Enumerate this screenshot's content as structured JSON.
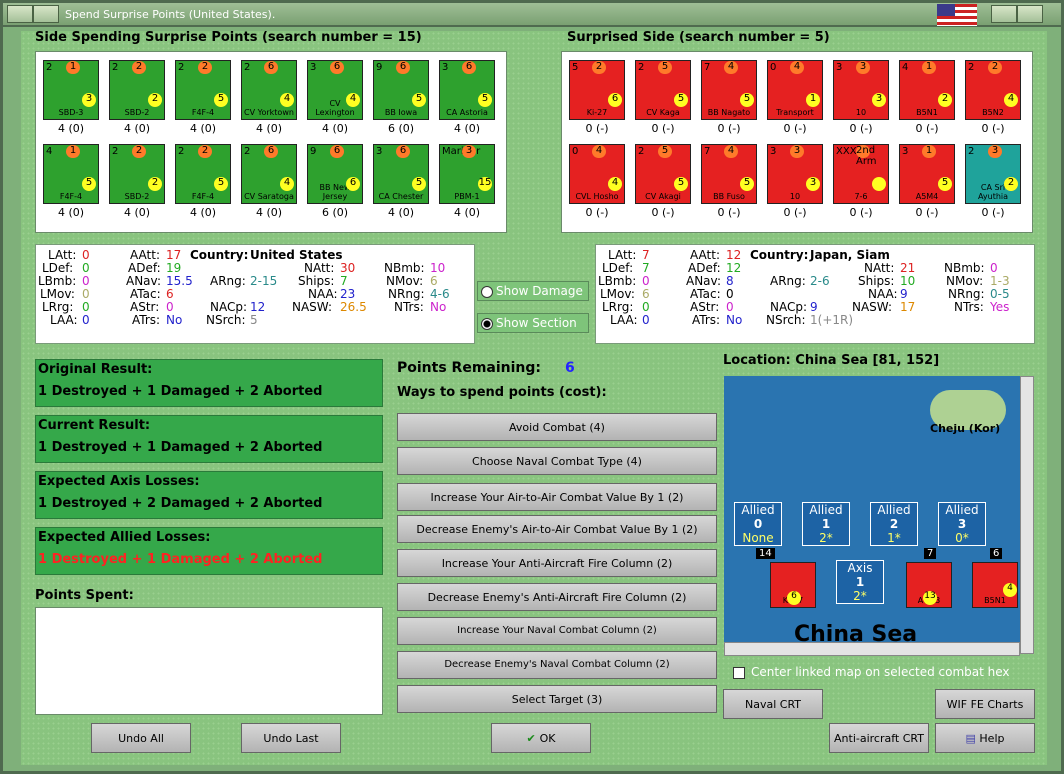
{
  "window": {
    "title": "Spend Surprise Points (United States)."
  },
  "left_header": "Side Spending Surprise Points (search number = 15)",
  "right_header": "Surprised Side (search number = 5)",
  "us_counters": [
    {
      "top": "2",
      "top_mid": "1",
      "name": "SBD-3",
      "bottom": "3",
      "val": "4 (0)"
    },
    {
      "top": "2",
      "top_mid": "2",
      "name": "SBD-2",
      "bottom": "2",
      "val": "4 (0)"
    },
    {
      "top": "2",
      "top_mid": "2",
      "name": "F4F-4",
      "bottom": "5",
      "val": "4 (0)"
    },
    {
      "top": "2",
      "top_mid": "6",
      "name": "CV Yorktown",
      "bottom": "4",
      "val": "4 (0)"
    },
    {
      "top": "3",
      "top_mid": "6",
      "name": "CV Lexington",
      "bottom": "4",
      "val": "4 (0)"
    },
    {
      "top": "9",
      "top_mid": "6",
      "name": "BB Iowa",
      "bottom": "5",
      "val": "6 (0)"
    },
    {
      "top": "3",
      "top_mid": "6",
      "name": "CA Astoria",
      "bottom": "5",
      "val": "4 (0)"
    },
    {
      "top": "4",
      "top_mid": "1",
      "name": "F4F-4",
      "bottom": "5",
      "val": "4 (0)"
    },
    {
      "top": "2",
      "top_mid": "2",
      "name": "SBD-2",
      "bottom": "2",
      "val": "4 (0)"
    },
    {
      "top": "2",
      "top_mid": "2",
      "name": "F4F-4",
      "bottom": "5",
      "val": "4 (0)"
    },
    {
      "top": "2",
      "top_mid": "6",
      "name": "CV Saratoga",
      "bottom": "4",
      "val": "4 (0)"
    },
    {
      "top": "9",
      "top_mid": "6",
      "name": "BB New Jersey",
      "bottom": "6",
      "val": "6 (0)"
    },
    {
      "top": "3",
      "top_mid": "6",
      "name": "CA Chester",
      "bottom": "5",
      "val": "4 (0)"
    },
    {
      "top": "Mariner",
      "top_mid": "3",
      "name": "PBM-1",
      "bottom": "15",
      "val": "4 (0)"
    }
  ],
  "jp_counters": [
    {
      "top": "5",
      "top_mid": "2",
      "name": "Ki-27",
      "bottom": "6",
      "val": "0 (-)"
    },
    {
      "top": "2",
      "top_mid": "5",
      "name": "CV Kaga",
      "bottom": "5",
      "val": "0 (-)"
    },
    {
      "top": "7",
      "top_mid": "4",
      "name": "BB Nagato",
      "bottom": "5",
      "val": "0 (-)"
    },
    {
      "top": "0",
      "top_mid": "4",
      "name": "Transport",
      "bottom": "1",
      "val": "0 (-)"
    },
    {
      "top": "3",
      "top_mid": "3",
      "name": "10",
      "bottom": "3",
      "val": "0 (-)"
    },
    {
      "top": "4",
      "top_mid": "1",
      "name": "B5N1",
      "bottom": "2",
      "val": "0 (-)"
    },
    {
      "top": "2",
      "top_mid": "2",
      "name": "B5N2",
      "bottom": "4",
      "val": "0 (-)"
    },
    {
      "top": "0",
      "top_mid": "4",
      "name": "CVL Hosho",
      "bottom": "4",
      "val": "0 (-)"
    },
    {
      "top": "2",
      "top_mid": "5",
      "name": "CV Akagi",
      "bottom": "5",
      "val": "0 (-)"
    },
    {
      "top": "7",
      "top_mid": "4",
      "name": "BB Fuso",
      "bottom": "5",
      "val": "0 (-)"
    },
    {
      "top": "3",
      "top_mid": "3",
      "name": "10",
      "bottom": "3",
      "val": "0 (-)"
    },
    {
      "top": "XXX",
      "top_mid": "2nd Arm",
      "name": "7-6",
      "bottom": "",
      "val": "0 (-)"
    },
    {
      "top": "3",
      "top_mid": "1",
      "name": "A5M4",
      "bottom": "5",
      "val": "0 (-)"
    },
    {
      "top": "2",
      "top_mid": "3",
      "name": "CA Sri Ayuthia",
      "bottom": "2",
      "val": "0 (-)"
    }
  ],
  "us_stats": {
    "country_label": "Country:",
    "country": "United States",
    "LAtt": "0",
    "LDef": "0",
    "LBmb": "0",
    "LMov": "0",
    "LRrg": "0",
    "LAA": "0",
    "AAtt": "17",
    "ADef": "19",
    "ANav": "15.5",
    "ATac": "6",
    "AStr": "0",
    "ATrs": "No",
    "ARng": "2-15",
    "NACp": "12",
    "NSrch": "5",
    "NAtt": "30",
    "Ships": "7",
    "NAA": "23",
    "NASW": "26.5",
    "NBmb": "10",
    "NMov": "6",
    "NRng": "4-6",
    "NTrs": "No"
  },
  "jp_stats": {
    "country_label": "Country:",
    "country": "Japan, Siam",
    "LAtt": "7",
    "LDef": "7",
    "LBmb": "0",
    "LMov": "6",
    "LRrg": "0",
    "LAA": "0",
    "AAtt": "12",
    "ADef": "12",
    "ANav": "8",
    "ATac": "0",
    "AStr": "0",
    "ATrs": "No",
    "ARng": "2-6",
    "NACp": "9",
    "NSrch": "1(+1R)",
    "NAtt": "21",
    "Ships": "10",
    "NAA": "9",
    "NASW": "17",
    "NBmb": "0",
    "NMov": "1-3",
    "NRng": "0-5",
    "NTrs": "Yes"
  },
  "options": {
    "show_damage": "Show Damage",
    "show_section": "Show Section"
  },
  "results": [
    {
      "title": "Original Result:",
      "text": "1 Destroyed + 1 Damaged + 2 Aborted"
    },
    {
      "title": "Current Result:",
      "text": "1 Destroyed + 1 Damaged + 2 Aborted"
    },
    {
      "title": "Expected Axis Losses:",
      "text": "1 Destroyed + 2 Damaged + 2 Aborted"
    },
    {
      "title": "Expected Allied Losses:",
      "text": "1 Destroyed + 1 Damaged + 2 Aborted"
    }
  ],
  "points_spent_label": "Points Spent:",
  "points_remaining_label": "Points Remaining:",
  "points_remaining": "6",
  "ways_label": "Ways to spend points (cost):",
  "actions": [
    "Avoid Combat (4)",
    "Choose Naval Combat Type (4)",
    "Increase Your Air-to-Air Combat Value By 1 (2)",
    "Decrease Enemy's Air-to-Air Combat Value By 1 (2)",
    "Increase Your Anti-Aircraft Fire Column (2)",
    "Decrease Enemy's Anti-Aircraft Fire Column (2)",
    "Increase Your Naval Combat Column (2)",
    "Decrease Enemy's Naval Combat Column (2)",
    "Select Target (3)"
  ],
  "location": "Location: China Sea [81, 152]",
  "map": {
    "island": "Cheju (Kor)",
    "sea": "China Sea",
    "hexes": [
      {
        "title": "Allied",
        "num": "0",
        "sub": "None"
      },
      {
        "title": "Allied",
        "num": "1",
        "sub": "2*"
      },
      {
        "title": "Allied",
        "num": "2",
        "sub": "1*"
      },
      {
        "title": "Allied",
        "num": "3",
        "sub": "0*"
      },
      {
        "title": "Axis",
        "num": "1",
        "sub": "2*"
      }
    ],
    "stack_counts": [
      "14",
      "7",
      "6"
    ],
    "units": [
      {
        "name": "Ki-27",
        "bottom": "6"
      },
      {
        "name": "A6M3",
        "bottom": "13"
      },
      {
        "name": "B5N1",
        "bottom": "4"
      }
    ]
  },
  "center_linked": "Center linked map on selected combat hex",
  "buttons": {
    "undo_all": "Undo All",
    "undo_last": "Undo Last",
    "ok": "OK",
    "naval_crt": "Naval CRT",
    "wif_charts": "WIF FE Charts",
    "aa_crt": "Anti-aircraft CRT",
    "help": "Help"
  },
  "colors": {
    "us_counter": "#2ea12e",
    "jp_counter": "#e52121",
    "siam_counter": "#1fa39b",
    "result_panel": "#35a84a",
    "background": "#89c47f"
  }
}
